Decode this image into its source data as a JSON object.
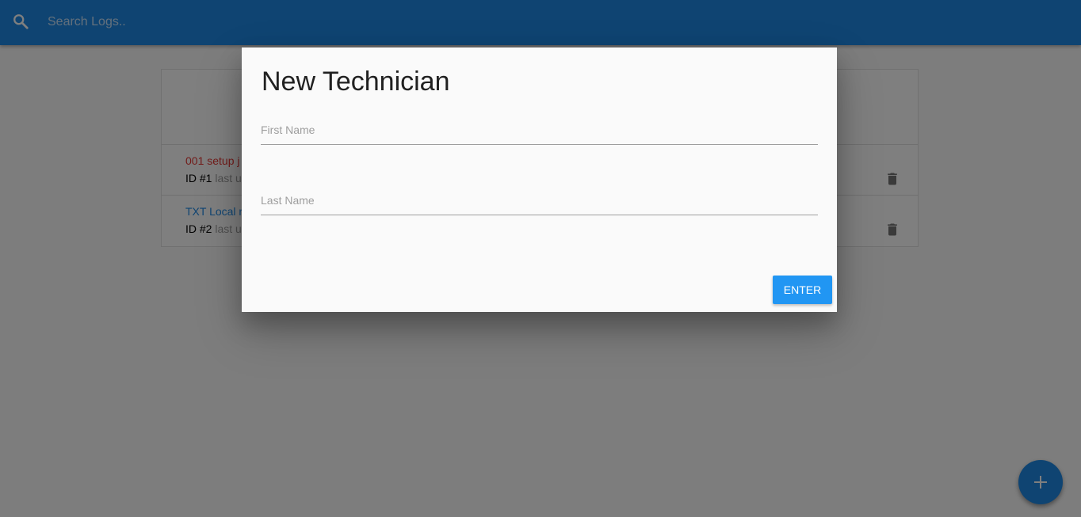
{
  "navbar": {
    "search_placeholder": "Search Logs..",
    "search_icon": "search-icon"
  },
  "logs": [
    {
      "title": "001 setup j",
      "attention": true,
      "id_label": "ID #1",
      "muted_text": "last u"
    },
    {
      "title": "TXT Local r",
      "attention": false,
      "id_label": "ID #2",
      "muted_text": "last u"
    }
  ],
  "modal": {
    "title": "New Technician",
    "first_name_label": "First Name",
    "last_name_label": "Last Name",
    "enter_label": "ENTER"
  },
  "fab": {
    "icon": "add-icon"
  },
  "colors": {
    "primary": "#1e88e5",
    "button": "#2196f3",
    "attention": "#e53935"
  }
}
